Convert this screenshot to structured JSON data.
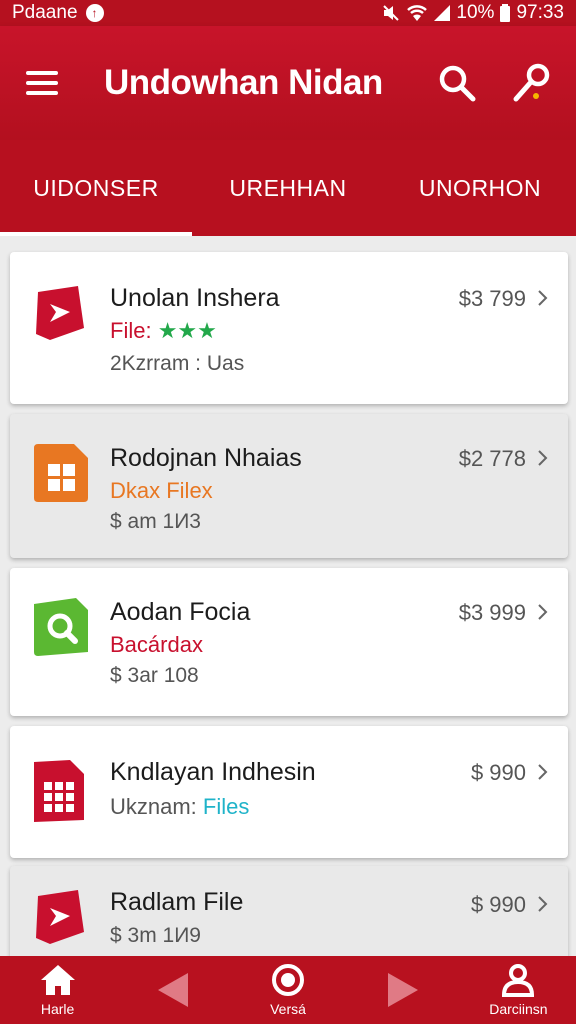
{
  "status_bar": {
    "carrier": "Pdaane",
    "battery": "10%",
    "time": "97:33"
  },
  "app_bar": {
    "title": "Undowhan Nidan"
  },
  "tabs": [
    {
      "label": "UIDONSER",
      "active": true
    },
    {
      "label": "UREHHAN",
      "active": false
    },
    {
      "label": "UNORHON",
      "active": false
    }
  ],
  "items": [
    {
      "title": "Unolan Inshera",
      "sub": "File: ",
      "stars": "★★★",
      "meta": "2Kzrram : Uas",
      "price": "$3 799"
    },
    {
      "title": "Rodojnan Nhaias",
      "sub": "Dkax Filex",
      "meta": "$ am 1И3",
      "price": "$2 778"
    },
    {
      "title": "Aodan Focia",
      "sub": "Bacárdax",
      "meta": "$ 3ar 108",
      "price": "$3 999"
    },
    {
      "title": "Kndlayan Indhesin",
      "sub_prefix": "Ukznam: ",
      "sub_highlight": "Files",
      "price": "$ 990"
    },
    {
      "title": "Radlam File",
      "meta": "$ 3m 1И9",
      "price": "$ 990"
    }
  ],
  "bottom_nav": [
    {
      "label": "Harle",
      "icon": "home-icon"
    },
    {
      "label": "",
      "icon": "back-arrow-icon"
    },
    {
      "label": "Versá",
      "icon": "record-icon"
    },
    {
      "label": "",
      "icon": "forward-arrow-icon"
    },
    {
      "label": "Darciinsn",
      "icon": "profile-icon"
    }
  ],
  "colors": {
    "primary": "#b5111f",
    "accent_red": "#c8102e",
    "orange": "#e87722",
    "green": "#5bb832",
    "cyan": "#1fb3c9",
    "star_green": "#22a84a"
  }
}
